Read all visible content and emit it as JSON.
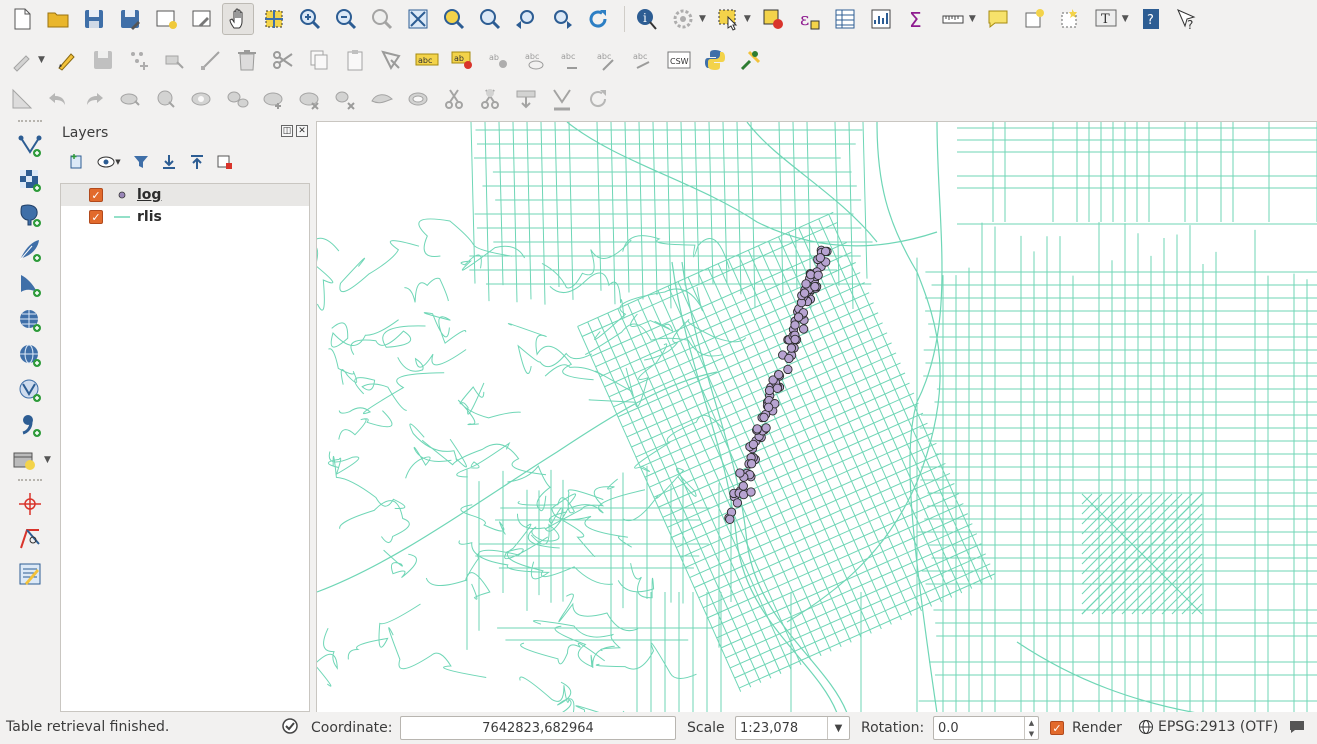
{
  "toolbar": {
    "file": [
      "new-project",
      "open-project",
      "save-project",
      "save-project-as",
      "new-print-composer",
      "composer-manager"
    ],
    "navigation": [
      "pan-map",
      "pan-to-selection",
      "zoom-in",
      "zoom-out",
      "zoom-native",
      "zoom-full",
      "zoom-to-selection",
      "zoom-to-layer",
      "zoom-last",
      "zoom-next",
      "refresh"
    ],
    "attributes": [
      "identify",
      "run-action",
      "select-features",
      "deselect",
      "expression-select",
      "open-attribute-table",
      "statistics",
      "sum",
      "measure",
      "map-tips",
      "new-bookmark",
      "show-bookmarks",
      "text-annotation",
      "help",
      "whats-this"
    ],
    "editing": [
      "current-edits",
      "toggle-editing",
      "save-edits",
      "add-feature",
      "move-feature",
      "node-tool",
      "delete-selected",
      "cut-features",
      "copy-features",
      "paste-features",
      "digitize"
    ],
    "labels": [
      "label-abc",
      "label-pin",
      "label-show-hide",
      "label-move",
      "label-rotate",
      "label-change"
    ],
    "csw_label": "CSW",
    "advanced": [
      "snap",
      "undo",
      "redo",
      "rotate-feature",
      "simplify",
      "add-ring",
      "add-part",
      "fill-ring",
      "delete-ring",
      "delete-part",
      "reshape",
      "offset",
      "split-features",
      "split-parts",
      "merge-attributes",
      "merge-selected",
      "rotate-symbols"
    ]
  },
  "left_toolbar": [
    "add-vector-layer",
    "add-raster-layer",
    "add-postgis-layer",
    "add-spatialite-layer",
    "add-mssql-layer",
    "add-wms-layer",
    "add-wcs-layer",
    "add-wfs-layer",
    "add-delimited-text-layer",
    "new-shapefile-layer",
    "add-gps-layer",
    "georeferencer",
    "virtual-layer"
  ],
  "layers_panel": {
    "title": "Layers",
    "float_btn": "◫",
    "close_btn": "✕",
    "layers": [
      {
        "name": "log",
        "checked": true,
        "symbol": "point",
        "color": "#9a87b8",
        "selected": true
      },
      {
        "name": "rlis",
        "checked": true,
        "symbol": "line",
        "color": "#6fd6b6",
        "selected": false
      }
    ]
  },
  "map": {
    "street_color": "#6fd6b6",
    "point_fill": "#b7a3d1",
    "point_stroke": "#2b2b2b"
  },
  "statusbar": {
    "message": "Table retrieval finished.",
    "coordinate_label": "Coordinate:",
    "coordinate_value": "7642823,682964",
    "scale_label": "Scale",
    "scale_value": "1:23,078",
    "rotation_label": "Rotation:",
    "rotation_value": "0.0",
    "render_label": "Render",
    "render_checked": true,
    "crs_label": "EPSG:2913 (OTF)"
  }
}
